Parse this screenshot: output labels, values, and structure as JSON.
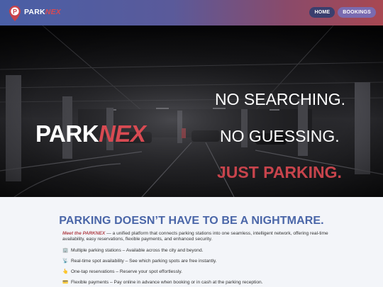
{
  "brand": {
    "part1": "PARK",
    "part2": "NEX"
  },
  "nav": {
    "home": "HOME",
    "bookings": "BOOKINGS"
  },
  "hero": {
    "brand_part1": "PARK",
    "brand_part2": "NEX",
    "tagline1": "NO SEARCHING.",
    "tagline2": "NO GUESSING.",
    "tagline3": "JUST PARKING."
  },
  "intro": {
    "headline": "PARKING DOESN’T HAVE TO BE A NIGHTMARE.",
    "lead_emphasis": "Meet the PARKNEX",
    "lead_text": " — a unified platform that connects parking stations into one seamless, intelligent network, offering real-time availability, easy reservations, flexible payments, and enhanced security."
  },
  "features": [
    {
      "icon": "🏢",
      "icon_name": "building-icon",
      "text": "Multiple parking stations – Available across the city and beyond."
    },
    {
      "icon": "📡",
      "icon_name": "satellite-icon",
      "text": "Real-time spot availability – See which parking spots are free instantly."
    },
    {
      "icon": "👆",
      "icon_name": "pointing-hand-icon",
      "text": "One-tap reservations – Reserve your spot effortlessly."
    },
    {
      "icon": "💳",
      "icon_name": "credit-card-icon",
      "text": "Flexible payments – Pay online in advance when booking or in cash at the parking reception."
    }
  ],
  "colors": {
    "accent_red": "#d84a52",
    "headline_blue": "#4a66a8",
    "header_left": "#4a5fa6",
    "header_right": "#a84852"
  }
}
